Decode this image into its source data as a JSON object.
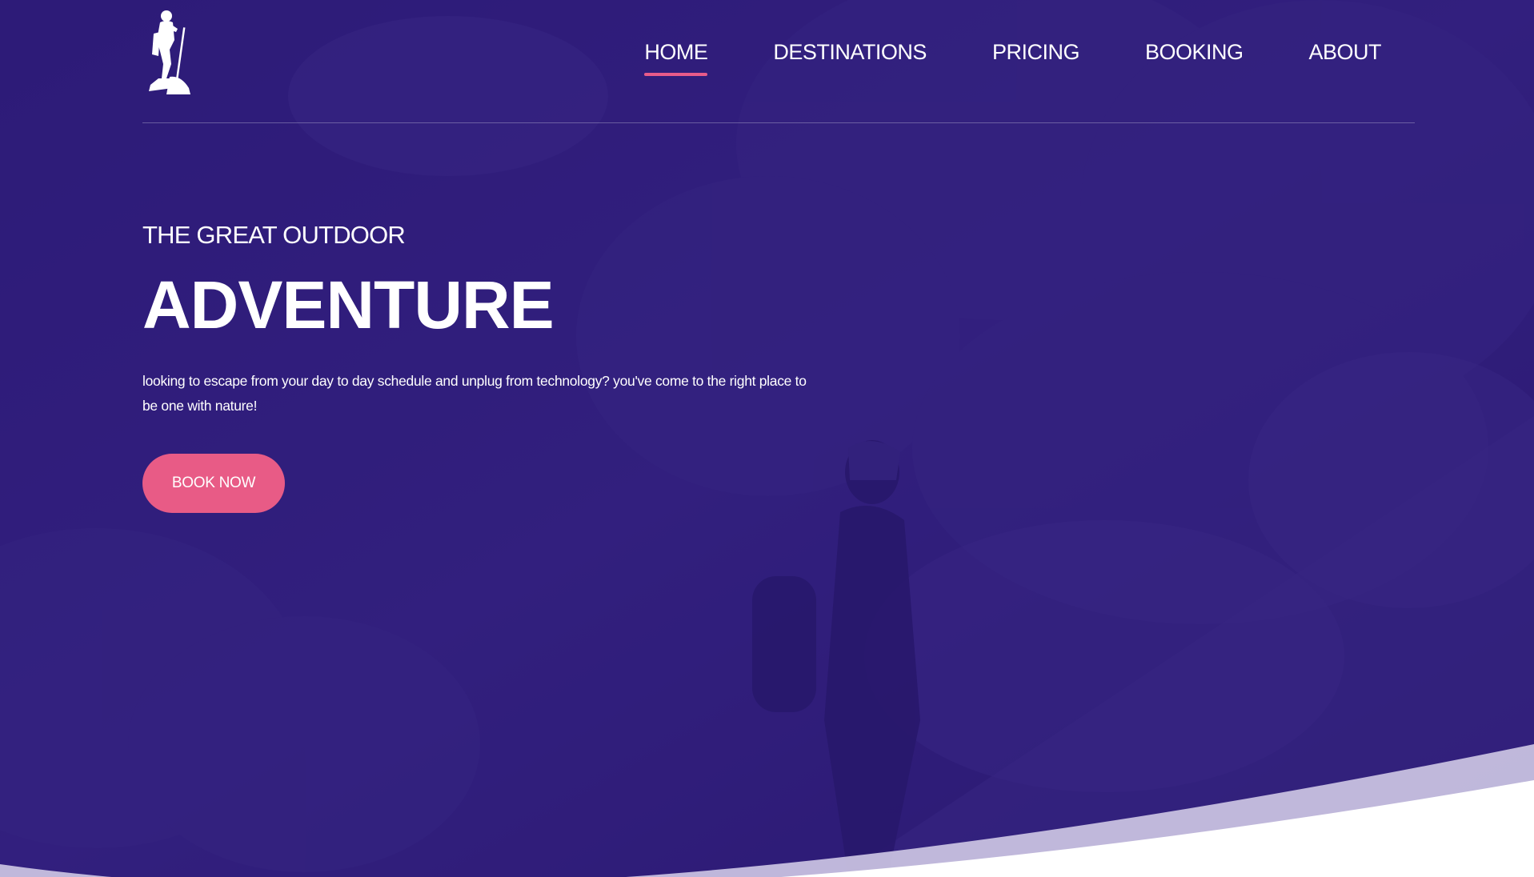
{
  "brand": {
    "logo_icon": "hiker-silhouette-icon"
  },
  "nav": {
    "items": [
      {
        "label": "HOME",
        "active": true
      },
      {
        "label": "DESTINATIONS",
        "active": false
      },
      {
        "label": "PRICING",
        "active": false
      },
      {
        "label": "BOOKING",
        "active": false
      },
      {
        "label": "ABOUT",
        "active": false
      }
    ]
  },
  "hero": {
    "eyebrow": "THE GREAT OUTDOOR",
    "headline": "ADVENTURE",
    "description": "looking to escape from your day to day schedule and unplug from technology? you've come to the right place to be one with nature!",
    "cta_label": "BOOK NOW"
  },
  "colors": {
    "overlay": "#2c1a78",
    "accent": "#e85b86",
    "text": "#ffffff",
    "wave": "#ffffff"
  }
}
